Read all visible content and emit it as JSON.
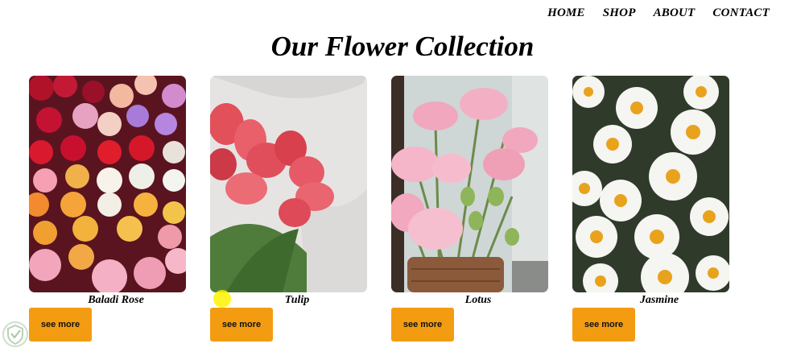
{
  "nav": {
    "items": [
      "HOME",
      "SHOP",
      "ABOUT",
      "CONTACT"
    ]
  },
  "page_title": "Our Flower Collection",
  "cards": [
    {
      "name": "Baladi Rose",
      "button": "see more",
      "image": "roses-photo"
    },
    {
      "name": "Tulip",
      "button": "see more",
      "image": "tulips-photo"
    },
    {
      "name": "Lotus",
      "button": "see more",
      "image": "lotus-photo"
    },
    {
      "name": "Jasmine",
      "button": "see more",
      "image": "daisies-photo"
    }
  ],
  "colors": {
    "button_bg": "#f39c12",
    "cursor_highlight": "#fff200"
  }
}
